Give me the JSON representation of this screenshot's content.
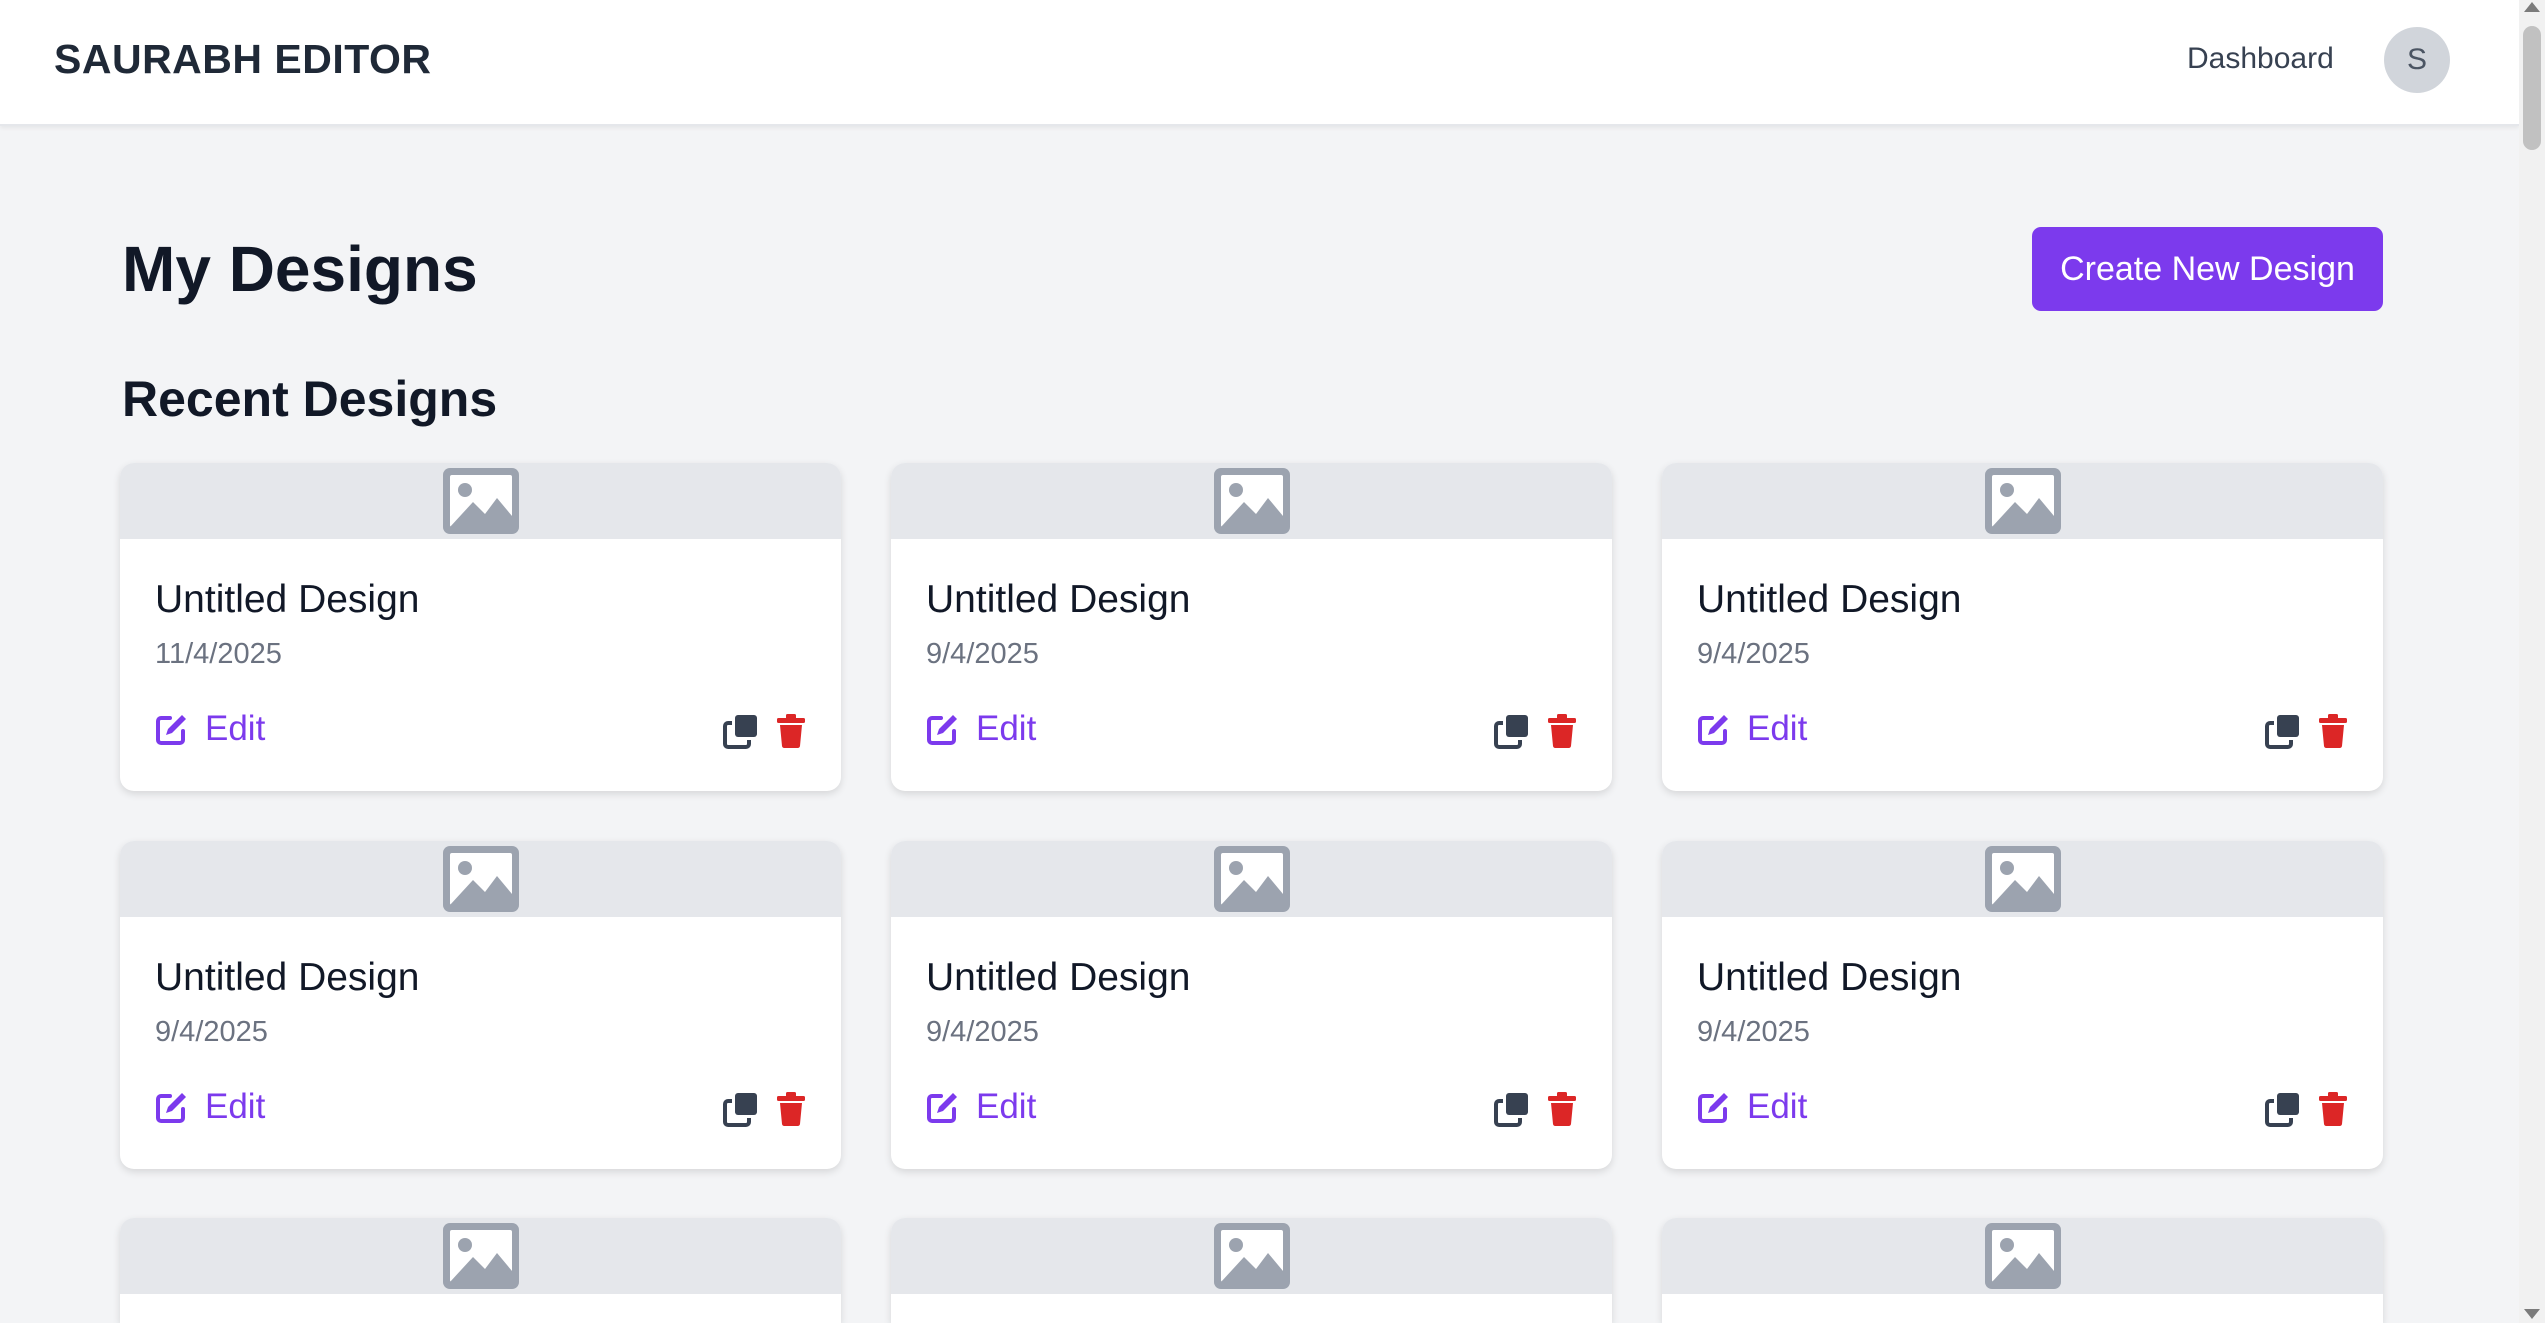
{
  "header": {
    "brand": "SAURABH EDITOR",
    "nav_dashboard": "Dashboard",
    "avatar_initial": "S"
  },
  "main": {
    "title": "My Designs",
    "create_button": "Create New Design",
    "section_title": "Recent Designs"
  },
  "cards": [
    {
      "title": "Untitled Design",
      "date": "11/4/2025",
      "edit_label": "Edit"
    },
    {
      "title": "Untitled Design",
      "date": "9/4/2025",
      "edit_label": "Edit"
    },
    {
      "title": "Untitled Design",
      "date": "9/4/2025",
      "edit_label": "Edit"
    },
    {
      "title": "Untitled Design",
      "date": "9/4/2025",
      "edit_label": "Edit"
    },
    {
      "title": "Untitled Design",
      "date": "9/4/2025",
      "edit_label": "Edit"
    },
    {
      "title": "Untitled Design",
      "date": "9/4/2025",
      "edit_label": "Edit"
    }
  ],
  "icons": {
    "thumbnail": "image-placeholder-icon",
    "edit": "edit-icon",
    "duplicate": "duplicate-icon",
    "delete": "trash-icon"
  },
  "colors": {
    "accent": "#7c3aed",
    "delete": "#dc2626",
    "duplicate": "#374151",
    "thumbnail_bg": "#e5e7eb",
    "page_bg": "#f3f4f6"
  }
}
